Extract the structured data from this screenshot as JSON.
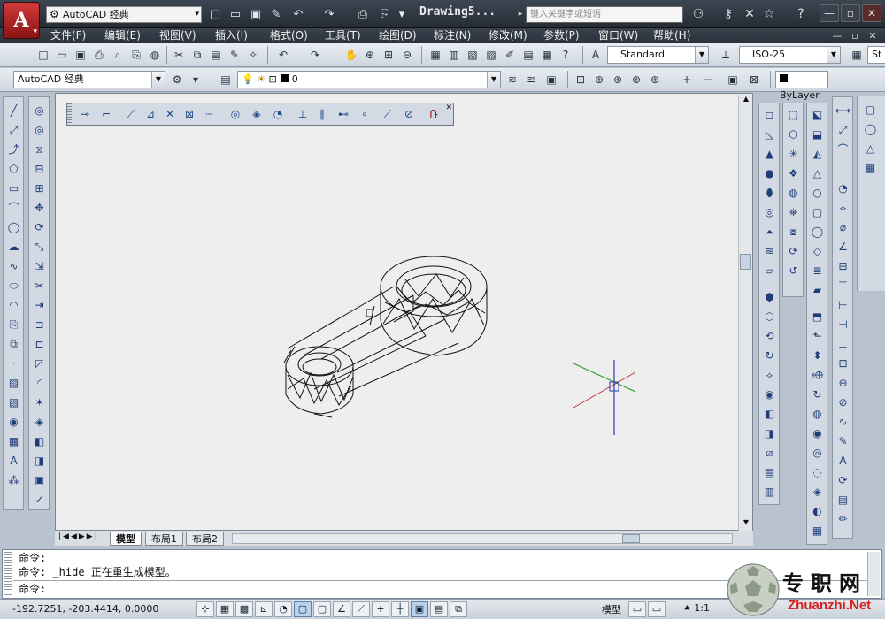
{
  "app_logo": "A",
  "workspace": "AutoCAD 经典",
  "document_title": "Drawing5...",
  "search_placeholder": "键入关键字或短语",
  "menu": [
    "文件(F)",
    "编辑(E)",
    "视图(V)",
    "插入(I)",
    "格式(O)",
    "工具(T)",
    "绘图(D)",
    "标注(N)",
    "修改(M)",
    "参数(P)",
    "窗口(W)",
    "帮助(H)"
  ],
  "toolbar2": {
    "text_style": "Standard",
    "dim_style": "ISO-25",
    "overflow": "St"
  },
  "toolbar3": {
    "workspace": "AutoCAD 经典",
    "layer": "0",
    "color": "ByLayer"
  },
  "layout_tabs": [
    "模型",
    "布局1",
    "布局2"
  ],
  "command_lines": [
    "命令:",
    "命令: _hide 正在重生成模型。",
    "命令:"
  ],
  "status": {
    "coordinates": "-192.7251, -203.4414, 0.0000",
    "model_label": "模型",
    "scale": "1:1"
  },
  "watermark": {
    "chinese": "专职网",
    "url": "Zhuanzhi.Net"
  },
  "colors": {
    "title_bg": "#2b323c",
    "canvas_bg": "#eeeeee",
    "toolbar_bg": "#dbe1e8",
    "logo_red": "#d62020"
  }
}
